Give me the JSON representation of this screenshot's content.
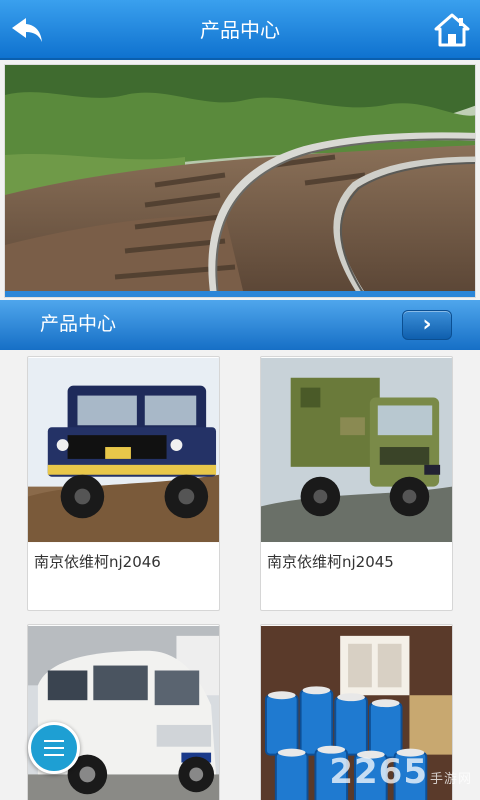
{
  "header": {
    "title": "产品中心"
  },
  "section": {
    "title": "产品中心"
  },
  "products": [
    {
      "name": "南京依维柯nj2046"
    },
    {
      "name": "南京依维柯nj2045"
    },
    {
      "name": ""
    },
    {
      "name": ""
    }
  ],
  "watermark": {
    "main": "2265",
    "sub": "手游网"
  },
  "colors": {
    "header_blue": "#1e82dd",
    "fab_blue": "#1e9fd3"
  }
}
